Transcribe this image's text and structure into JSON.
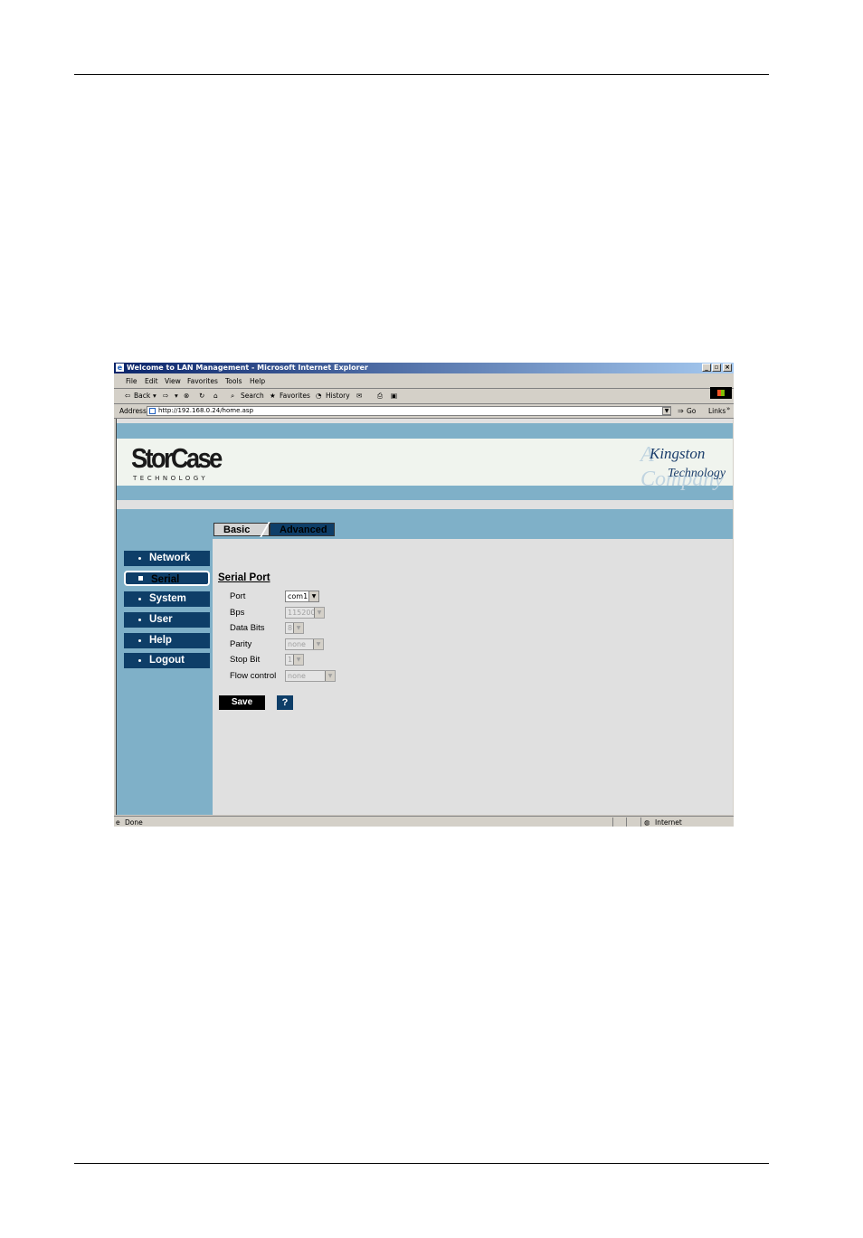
{
  "window": {
    "title": "Welcome to LAN Management - Microsoft Internet Explorer"
  },
  "menu": [
    "File",
    "Edit",
    "View",
    "Favorites",
    "Tools",
    "Help"
  ],
  "toolbar": {
    "back": "Back",
    "search": "Search",
    "favorites": "Favorites",
    "history": "History"
  },
  "address": {
    "label": "Address",
    "url": "http://192.168.0.24/home.asp",
    "go": "Go",
    "links": "Links"
  },
  "banner": {
    "logo": "StorCase",
    "logo_sub": "TECHNOLOGY",
    "kingston": "Kingston",
    "kingston2": "Technology",
    "kingston_ghost": "A Company"
  },
  "tabs": {
    "basic": "Basic",
    "advanced": "Advanced"
  },
  "nav": [
    "Network",
    "Serial",
    "System",
    "User",
    "Help",
    "Logout"
  ],
  "form": {
    "title": "Serial Port",
    "fields": [
      {
        "label": "Port",
        "value": "com1"
      },
      {
        "label": "Bps",
        "value": "115200"
      },
      {
        "label": "Data Bits",
        "value": "8"
      },
      {
        "label": "Parity",
        "value": "none"
      },
      {
        "label": "Stop Bit",
        "value": "1"
      },
      {
        "label": "Flow control",
        "value": "none"
      }
    ],
    "save": "Save",
    "help": "?"
  },
  "status": {
    "left": "Done",
    "zone": "Internet"
  }
}
